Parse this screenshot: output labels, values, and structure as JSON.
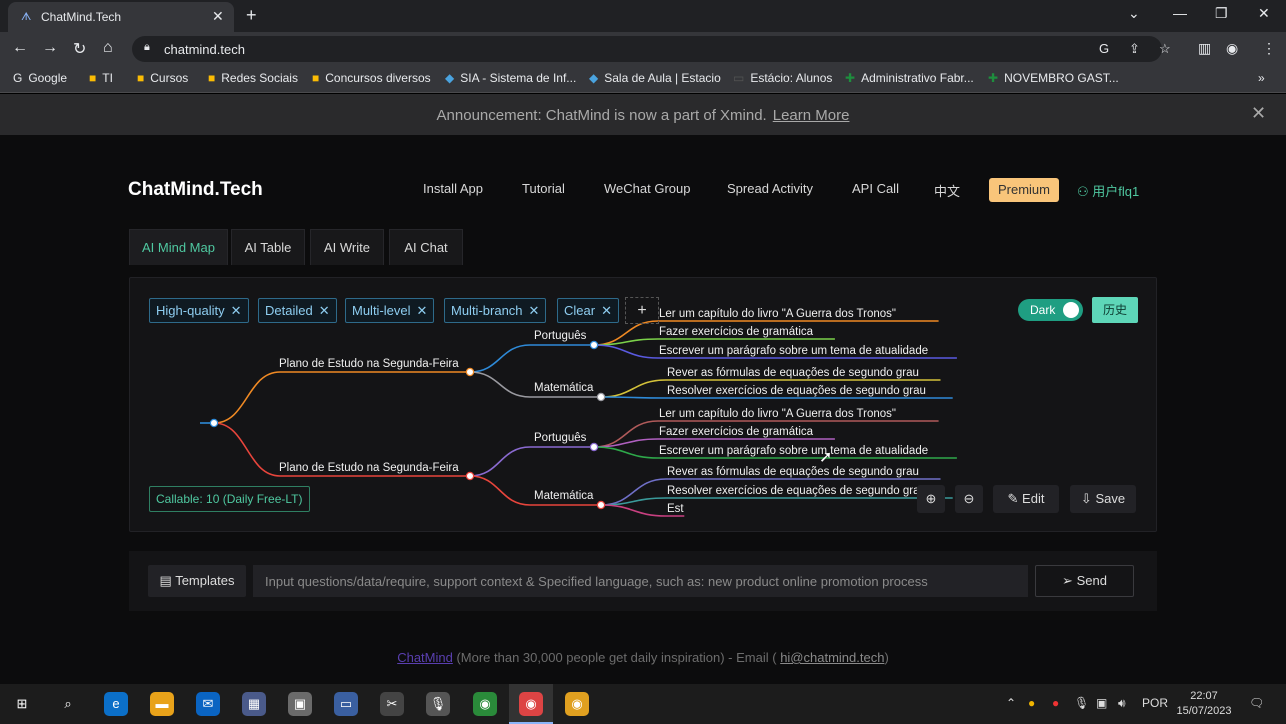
{
  "browser": {
    "tab_title": "ChatMind.Tech",
    "url": "chatmind.tech",
    "bookmarks": [
      "Google",
      "TI",
      "Cursos",
      "Redes Sociais",
      "Concursos diversos",
      "SIA - Sistema de Inf...",
      "Sala de Aula | Estacio",
      "Estácio: Alunos",
      "Administrativo Fabr...",
      "NOVEMBRO GAST..."
    ]
  },
  "announcement": {
    "text": "Announcement: ChatMind is now a part of Xmind.",
    "link": "Learn More"
  },
  "header": {
    "logo": "ChatMind.Tech",
    "nav": [
      "Install App",
      "Tutorial",
      "WeChat Group",
      "Spread Activity",
      "API Call",
      "中文"
    ],
    "premium": "Premium",
    "user": "用户flq1"
  },
  "tabs": [
    "AI Mind Map",
    "AI Table",
    "AI Write",
    "AI Chat"
  ],
  "chips": [
    "High-quality",
    "Detailed",
    "Multi-level",
    "Multi-branch",
    "Clear"
  ],
  "toggle": {
    "label": "Dark"
  },
  "history_label": "历史",
  "mindmap": {
    "branches": [
      {
        "label": "Plano de Estudo na Segunda-Feira",
        "children": [
          {
            "label": "Português",
            "leaves": [
              "Ler um capítulo do livro \"A Guerra dos Tronos\"",
              "Fazer exercícios de gramática",
              "Escrever um parágrafo sobre um tema de atualidade"
            ]
          },
          {
            "label": "Matemática",
            "leaves": [
              "Rever as fórmulas de equações de segundo grau",
              "Resolver exercícios de equações de segundo grau"
            ]
          }
        ]
      },
      {
        "label": "Plano de Estudo na Segunda-Feira",
        "children": [
          {
            "label": "Português",
            "leaves": [
              "Ler um capítulo do livro \"A Guerra dos Tronos\"",
              "Fazer exercícios de gramática",
              "Escrever um parágrafo sobre um tema de atualidade"
            ]
          },
          {
            "label": "Matemática",
            "leaves": [
              "Rever as fórmulas de equações de segundo grau",
              "Resolver exercícios de equações de segundo grau",
              "Est"
            ]
          }
        ]
      }
    ]
  },
  "callable": "Callable: 10 (Daily Free-LT)",
  "controls": {
    "edit": "Edit",
    "save": "Save"
  },
  "input": {
    "templates": "Templates",
    "placeholder": "Input questions/data/require, support context & Specified language, such as: new product online promotion process",
    "send": "Send"
  },
  "footer": {
    "link": "ChatMind",
    "text": " (More than 30,000 people get daily inspiration) - Email ( ",
    "email": "hi@chatmind.tech",
    "close": ")"
  },
  "taskbar": {
    "lang": "POR",
    "time": "22:07",
    "date": "15/07/2023"
  },
  "colors": {
    "accent": "#4fc8a0",
    "premium": "#f9c57a",
    "orange": "#f08a24",
    "red": "#e8453c",
    "blue": "#2e8ad8"
  }
}
